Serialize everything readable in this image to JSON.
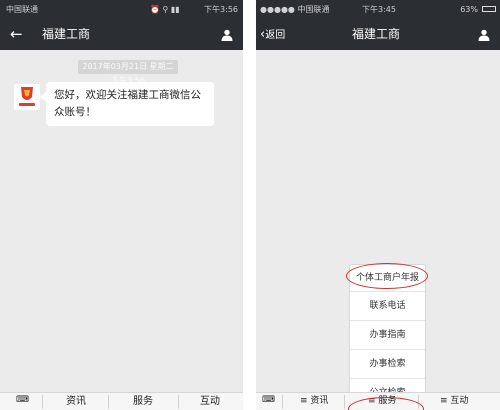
{
  "colors": {
    "header_bg": "#2b2e33",
    "chat_bg": "#ebebeb",
    "highlight": "#d0302f"
  },
  "left": {
    "status": {
      "carrier": "中国联通",
      "time": "下午3:56"
    },
    "nav": {
      "title": "福建工商",
      "back_icon": "back-arrow-icon",
      "profile_icon": "person-icon"
    },
    "timestamp": "2017年03月21日 星期二 下午3:56",
    "message": {
      "avatar_label": "福建工商",
      "text": "您好，欢迎关注福建工商微信公众账号！"
    },
    "bottom": {
      "menus": [
        "资讯",
        "服务",
        "互动"
      ]
    }
  },
  "right": {
    "status": {
      "carrier": "●●●●● 中国联通",
      "time": "下午3:45",
      "battery": "63%"
    },
    "nav": {
      "back": "返回",
      "title": "福建工商",
      "profile_icon": "person-icon"
    },
    "menu_items": [
      "个体工商户年报",
      "联系电话",
      "办事指南",
      "办事检索",
      "公文检索"
    ],
    "bottom": {
      "menus": [
        "资讯",
        "服务",
        "互动"
      ]
    }
  }
}
